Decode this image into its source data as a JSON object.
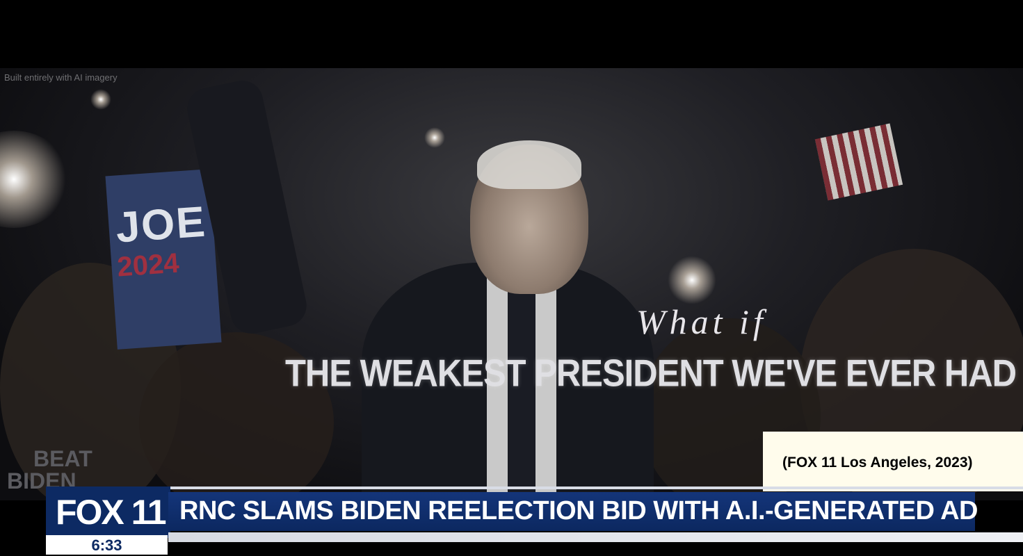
{
  "video": {
    "ai_note": "Built entirely with AI imagery",
    "sign_name": "JOE",
    "sign_year": "2024",
    "what_if": "What if",
    "headline": "THE WEAKEST PRESIDENT WE'VE EVER HAD",
    "logo_line1": "BEAT",
    "logo_line2": "BIDEN"
  },
  "caption": "(FOX 11 Los Angeles, 2023)",
  "lower_third": {
    "station": "FOX 11",
    "time": "6:33",
    "headline": "RNC SLAMS BIDEN REELECTION BID WITH A.I.-GENERATED AD",
    "colors": {
      "bar": "#0d2a63",
      "text": "#ffffff"
    }
  }
}
